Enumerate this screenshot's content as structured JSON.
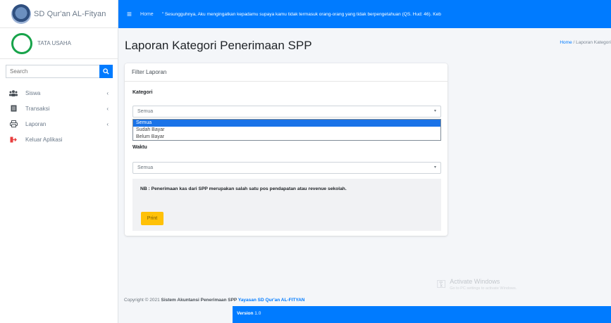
{
  "brand": {
    "name": "SD Qur'an AL-Fityan"
  },
  "user": {
    "name": "TATA USAHA"
  },
  "search": {
    "placeholder": "Search"
  },
  "sidebar": {
    "items": [
      {
        "label": "Siswa",
        "icon": "users-icon"
      },
      {
        "label": "Transaksi",
        "icon": "receipt-icon"
      },
      {
        "label": "Laporan",
        "icon": "printer-icon"
      },
      {
        "label": "Keluar Aplikasi",
        "icon": "logout-icon"
      }
    ]
  },
  "topbar": {
    "home": "Home",
    "marquee": "\" Sesungguhnya, Aku mengingatkan kepadamu supaya kamu tidak termasuk orang-orang yang tidak berpengetahuan (QS. Hud: 46). Keb"
  },
  "page": {
    "title": "Laporan Kategori Penerimaan SPP",
    "breadcrumb_home": "Home",
    "breadcrumb_current": "/ Laporan Kategori"
  },
  "card": {
    "header": "Filter Laporan",
    "kategori_label": "Kategori",
    "kategori_value": "Semua",
    "kategori_options": [
      "Semua",
      "Sudah Bayar",
      "Belum Bayar"
    ],
    "kategori_selected_index": 0,
    "waktu_label": "Waktu",
    "waktu_value": "Semua",
    "note": "NB : Penerimaan kas dari SPP merupakan salah satu pos pendapatan atau revenue sekolah.",
    "print_label": "Print"
  },
  "watermark": {
    "title": "Activate Windows",
    "subtitle": "Go to PC settings to activate Windows."
  },
  "footer": {
    "prefix": "Copyright © 2021 ",
    "app": "Sistem Akuntansi Penerimaan SPP ",
    "org": "Yayasan SD Qur'an AL-FITYAN",
    "version_label": "Version",
    "version": "1.0"
  },
  "colors": {
    "primary": "#007bff",
    "print": "#ffc107",
    "avatar_ring": "#17a34a"
  }
}
